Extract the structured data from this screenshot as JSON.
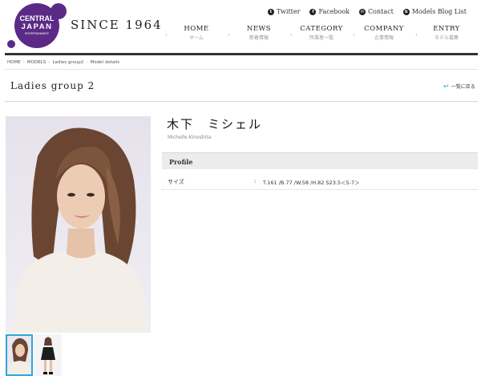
{
  "brand": {
    "logo_line1": "CENTRAL",
    "logo_line2": "JAPAN",
    "logo_line3": "ENTERTAINMENT",
    "since": "SINCE 1964",
    "logo_color": "#5b2a86"
  },
  "top_links": [
    {
      "label": "Twitter",
      "icon": "twitter-icon",
      "glyph": "t"
    },
    {
      "label": "Facebook",
      "icon": "facebook-icon",
      "glyph": "f"
    },
    {
      "label": "Contact",
      "icon": "mail-icon",
      "glyph": "✉"
    },
    {
      "label": "Models Blog List",
      "icon": "blog-icon",
      "glyph": "b"
    }
  ],
  "nav": [
    {
      "en": "HOME",
      "jp": "ホーム"
    },
    {
      "en": "NEWS",
      "jp": "新着情報"
    },
    {
      "en": "CATEGORY",
      "jp": "所属者一覧"
    },
    {
      "en": "COMPANY",
      "jp": "企業情報"
    },
    {
      "en": "ENTRY",
      "jp": "モデル募集"
    }
  ],
  "breadcrumb": [
    "HOME",
    "MODELS",
    "Ladies group2",
    "Model details"
  ],
  "breadcrumb_sep": "›",
  "section_title": "Ladies group 2",
  "back_link": "一覧に戻る",
  "model": {
    "name_jp": "木下　ミシェル",
    "name_en": "Michelle Kinoshita"
  },
  "profile": {
    "heading": "Profile",
    "rows": [
      {
        "label": "サイズ",
        "colon": ":",
        "value": "T.161 /B.77 /W.58 /H.82  S23.5＜5-7＞"
      }
    ]
  },
  "accent_color": "#2fa6d8"
}
